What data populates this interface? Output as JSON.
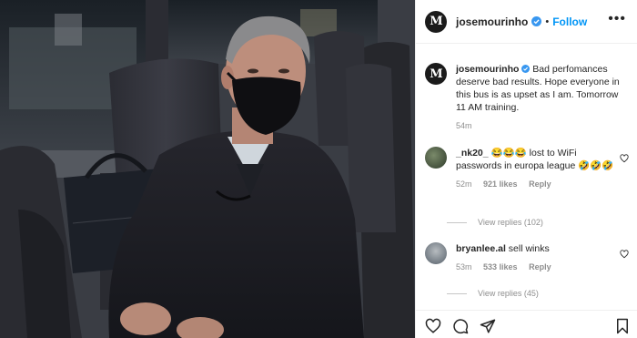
{
  "post": {
    "username": "josemourinho",
    "follow_label": "Follow",
    "dot": "•",
    "caption_username": "josemourinho",
    "caption_text": "Bad perfomances deserve bad results. Hope everyone in this bus is as upset as I am. Tomorrow 11 AM training.",
    "caption_time": "54m"
  },
  "comments": [
    {
      "username": "_nk20_",
      "text": "😂😂😂 lost to WiFi passwords in europa league 🤣🤣🤣",
      "time": "52m",
      "likes": "921 likes",
      "reply_label": "Reply",
      "view_replies": "View replies (102)"
    },
    {
      "username": "bryanlee.al",
      "text": "sell winks",
      "time": "53m",
      "likes": "533 likes",
      "reply_label": "Reply",
      "view_replies": "View replies (45)"
    }
  ],
  "icons": {
    "verified": "verified-badge-icon",
    "more": "more-options-icon",
    "like": "heart-icon",
    "comment": "comment-icon",
    "share": "share-icon",
    "save": "bookmark-icon"
  },
  "colors": {
    "accent": "#0095f6",
    "muted": "#8e8e8e",
    "text": "#262626"
  }
}
